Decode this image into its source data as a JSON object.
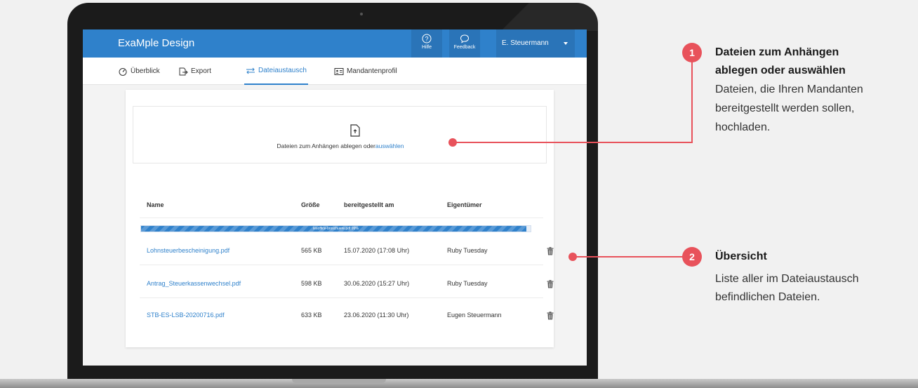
{
  "app": {
    "title": "ExaMple Design",
    "help_label": "Hilfe",
    "feedback_label": "Feedback",
    "user_name": "E. Steuermann"
  },
  "tabs": [
    {
      "label": "Überblick",
      "icon": "gauge-icon"
    },
    {
      "label": "Export",
      "icon": "export-icon"
    },
    {
      "label": "Dateiaustausch",
      "icon": "swap-arrows-icon",
      "active": true
    },
    {
      "label": "Mandantenprofil",
      "icon": "id-card-icon"
    }
  ],
  "dropzone": {
    "text": "Dateien zum Anhängen ablegen oder",
    "link": "auswählen",
    "icon": "upload-file-icon"
  },
  "table": {
    "headers": [
      "Name",
      "Größe",
      "bereitgestellt am",
      "Eigentümer"
    ],
    "upload": {
      "label": "lexoffice-broschuere.pdf 99%",
      "progress": 0.99
    },
    "rows": [
      {
        "name": "Lohnsteuerbescheinigung.pdf",
        "size": "565 KB",
        "date": "15.07.2020 (17:08 Uhr)",
        "owner": "Ruby Tuesday"
      },
      {
        "name": "Antrag_Steuerkassenwechsel.pdf",
        "size": "598 KB",
        "date": "30.06.2020 (15:27 Uhr)",
        "owner": "Ruby Tuesday"
      },
      {
        "name": "STB-ES-LSB-20200716.pdf",
        "size": "633 KB",
        "date": "23.06.2020 (11:30 Uhr)",
        "owner": "Eugen Steuermann"
      }
    ]
  },
  "annotations": [
    {
      "number": "1",
      "title_line1": "Dateien zum Anhängen",
      "title_line2": "ablegen oder auswählen",
      "desc_line1": "Dateien, die Ihren Mandanten",
      "desc_line2": "bereitgestellt werden sollen,",
      "desc_line3": "hochladen."
    },
    {
      "number": "2",
      "title": "Übersicht",
      "desc_line1": "Liste aller im Dateiaustausch",
      "desc_line2": "befindlichen Dateien."
    }
  ],
  "colors": {
    "accent": "#2f81cb",
    "annotation": "#e8525b"
  }
}
